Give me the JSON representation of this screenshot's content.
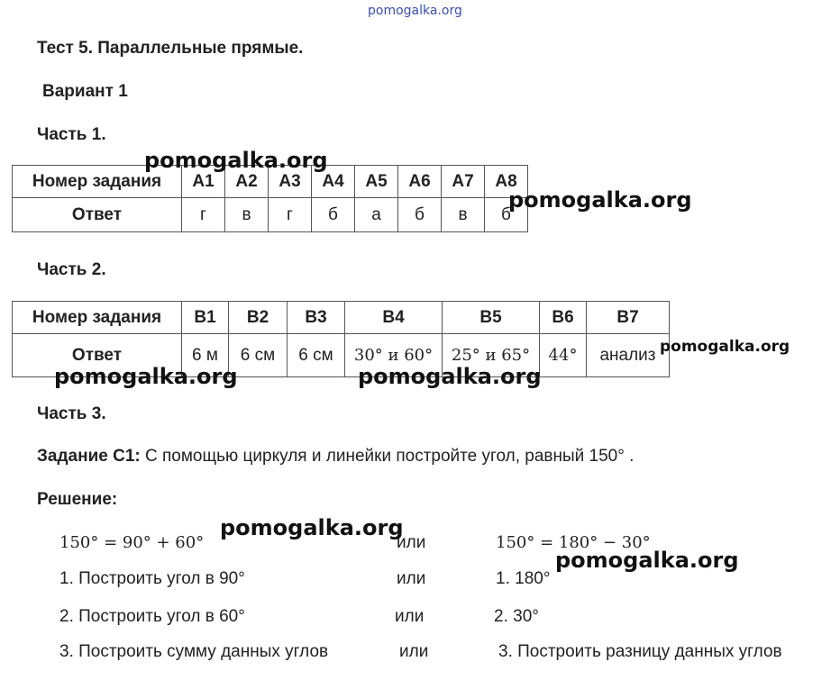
{
  "watermark": "pomogalka.org",
  "title": "Тест 5. Параллельные прямые.",
  "variant": "Вариант 1",
  "part1": {
    "heading": "Часть 1.",
    "row_label_task": "Номер задания",
    "row_label_answer": "Ответ",
    "tasks": [
      "A1",
      "A2",
      "A3",
      "A4",
      "A5",
      "A6",
      "A7",
      "A8"
    ],
    "answers": [
      "г",
      "в",
      "г",
      "б",
      "а",
      "б",
      "в",
      "б"
    ]
  },
  "part2": {
    "heading": "Часть 2.",
    "row_label_task": "Номер задания",
    "row_label_answer": "Ответ",
    "tasks": [
      "B1",
      "B2",
      "B3",
      "B4",
      "B5",
      "B6",
      "B7"
    ],
    "answers": [
      "6 м",
      "6 см",
      "6 см",
      "30° и 60°",
      "25° и 65°",
      "44°",
      "анализ"
    ]
  },
  "part3": {
    "heading": "Часть 3.",
    "task_label": "Задание С1:",
    "task_text": "С помощью циркуля и линейки постройте угол, равный 150° .",
    "solution_label": "Решение:",
    "left_lines": [
      "150° = 90° + 60°",
      "1. Построить угол в 90°",
      "2. Построить угол в 60°",
      "3. Построить сумму данных углов"
    ],
    "or_word": "или",
    "right_lines": [
      "150° = 180° − 30°",
      "1. 180°",
      "2. 30°",
      "3. Построить разницу данных углов"
    ]
  }
}
